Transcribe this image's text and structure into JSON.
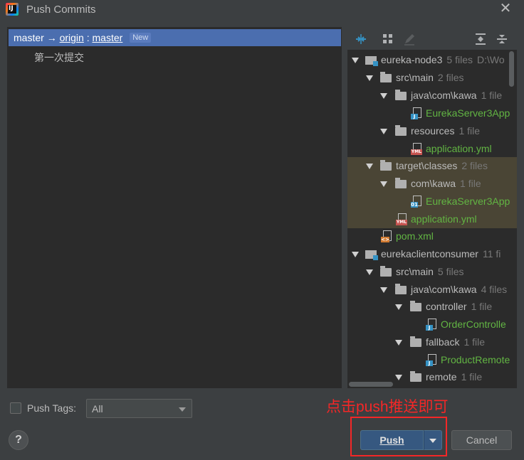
{
  "window": {
    "title": "Push Commits",
    "app_icon": "intellij-idea-icon",
    "close_icon": "close-icon"
  },
  "left_panel": {
    "repo": {
      "local_branch": "master",
      "arrow": "→",
      "remote": "origin",
      "separator": ":",
      "remote_branch": "master",
      "badge": "New"
    },
    "commits": [
      {
        "message": "第一次提交"
      }
    ]
  },
  "toolbar": {
    "icons": [
      "expand-collapse-icon",
      "group-by-icon",
      "edit-icon",
      "expand-all-icon",
      "collapse-all-icon"
    ]
  },
  "tree": [
    {
      "name": "eureka-node3",
      "count": "5 files",
      "path": "D:\\Wo",
      "kind": "module"
    },
    {
      "name": "src\\main",
      "count": "2 files",
      "kind": "folder"
    },
    {
      "name": "java\\com\\kawa",
      "count": "1 file",
      "kind": "folder"
    },
    {
      "name": "EurekaServer3App",
      "kind": "java-file"
    },
    {
      "name": "resources",
      "count": "1 file",
      "kind": "folder"
    },
    {
      "name": "application.yml",
      "kind": "yml-file"
    },
    {
      "name": "target\\classes",
      "count": "2 files",
      "kind": "folder"
    },
    {
      "name": "com\\kawa",
      "count": "1 file",
      "kind": "folder"
    },
    {
      "name": "EurekaServer3App",
      "kind": "class-file"
    },
    {
      "name": "application.yml",
      "kind": "yml-file"
    },
    {
      "name": "pom.xml",
      "kind": "xml-file"
    },
    {
      "name": "eurekaclientconsumer",
      "count": "11 fi",
      "kind": "module"
    },
    {
      "name": "src\\main",
      "count": "5 files",
      "kind": "folder"
    },
    {
      "name": "java\\com\\kawa",
      "count": "4 files",
      "kind": "folder"
    },
    {
      "name": "controller",
      "count": "1 file",
      "kind": "folder"
    },
    {
      "name": "OrderControlle",
      "kind": "java-file"
    },
    {
      "name": "fallback",
      "count": "1 file",
      "kind": "folder"
    },
    {
      "name": "ProductRemote",
      "kind": "java-file"
    },
    {
      "name": "remote",
      "count": "1 file",
      "kind": "folder"
    }
  ],
  "bottom": {
    "push_tags_label": "Push Tags:",
    "push_tags_checked": false,
    "tags_select_value": "All",
    "annotation": "点击push推送即可",
    "help_label": "?",
    "push_label": "Push",
    "cancel_label": "Cancel"
  },
  "colors": {
    "accent": "#4b6eaf",
    "annotation": "#f42727",
    "added_file": "#62b543",
    "modified_file": "#6897bb"
  }
}
